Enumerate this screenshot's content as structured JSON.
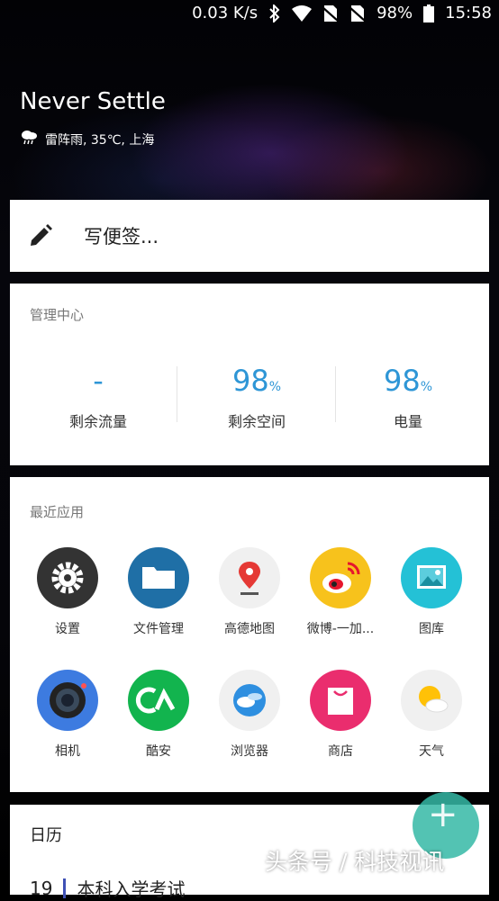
{
  "status_bar": {
    "speed": "0.03 K/s",
    "battery": "98%",
    "time": "15:58"
  },
  "hero": {
    "title": "Never Settle",
    "weather": "雷阵雨, 35℃, 上海"
  },
  "note_card": {
    "placeholder": "写便签..."
  },
  "management": {
    "title": "管理中心",
    "stats": [
      {
        "value": "-",
        "unit": "",
        "label": "剩余流量"
      },
      {
        "value": "98",
        "unit": "%",
        "label": "剩余空间"
      },
      {
        "value": "98",
        "unit": "%",
        "label": "电量"
      }
    ]
  },
  "recent_apps": {
    "title": "最近应用",
    "apps": [
      {
        "label": "设置",
        "icon": "settings-icon"
      },
      {
        "label": "文件管理",
        "icon": "folder-icon"
      },
      {
        "label": "高德地图",
        "icon": "map-pin-icon"
      },
      {
        "label": "微博-一加...",
        "icon": "weibo-icon"
      },
      {
        "label": "图库",
        "icon": "gallery-icon"
      },
      {
        "label": "相机",
        "icon": "camera-icon"
      },
      {
        "label": "酷安",
        "icon": "coolapk-icon"
      },
      {
        "label": "浏览器",
        "icon": "browser-icon"
      },
      {
        "label": "商店",
        "icon": "store-icon"
      },
      {
        "label": "天气",
        "icon": "weather-icon"
      }
    ]
  },
  "calendar": {
    "title": "日历",
    "event": "本科入学考试",
    "day": "19"
  },
  "watermark": "头条号 / 科技视讯",
  "colors": {
    "accent": "#2e96d6",
    "card": "#ffffff"
  }
}
